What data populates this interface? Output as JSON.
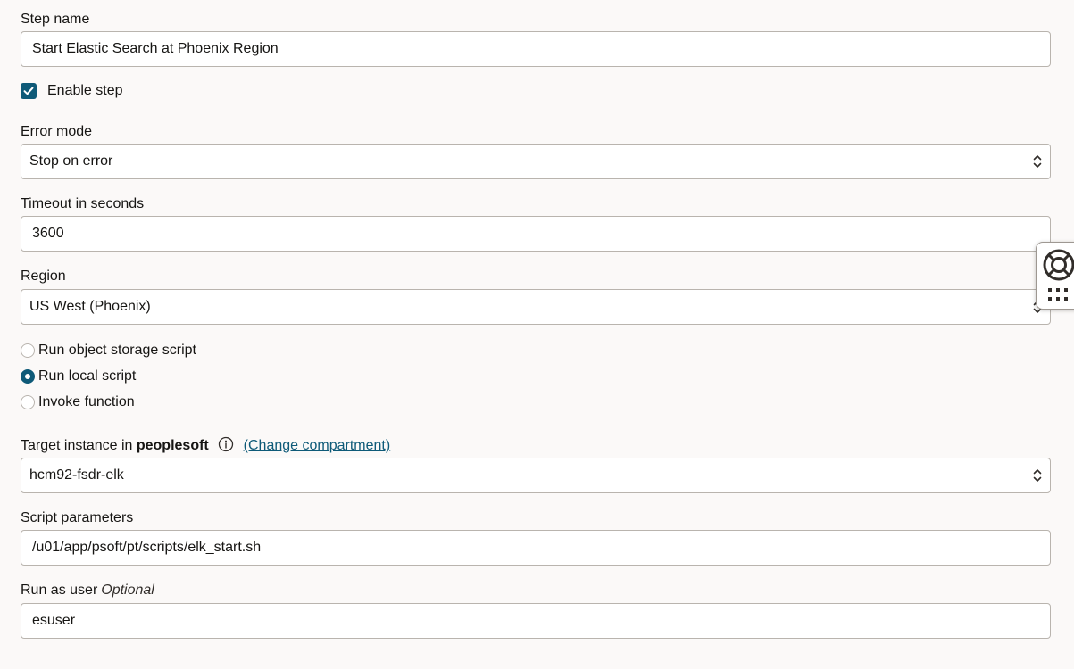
{
  "step_name": {
    "label": "Step name",
    "value": "Start Elastic Search at Phoenix Region"
  },
  "enable_step": {
    "label": "Enable step",
    "checked": true
  },
  "error_mode": {
    "label": "Error mode",
    "value": "Stop on error"
  },
  "timeout": {
    "label": "Timeout in seconds",
    "value": "3600"
  },
  "region": {
    "label": "Region",
    "value": "US West (Phoenix)"
  },
  "script_type": {
    "options": [
      {
        "label": "Run object storage script",
        "selected": false
      },
      {
        "label": "Run local script",
        "selected": true
      },
      {
        "label": "Invoke function",
        "selected": false
      }
    ]
  },
  "target_instance": {
    "label_prefix": "Target instance in",
    "compartment": "peoplesoft",
    "change_link": "(Change compartment)",
    "value": "hcm92-fsdr-elk"
  },
  "script_parameters": {
    "label": "Script parameters",
    "value": "/u01/app/psoft/pt/scripts/elk_start.sh"
  },
  "run_as_user": {
    "label": "Run as user",
    "optional": "Optional",
    "value": "esuser"
  },
  "colors": {
    "accent": "#0e5a78",
    "border": "#b9b4ae",
    "background": "#fbf9f8"
  },
  "icons": {
    "checkbox": "checkmark-icon",
    "select": "chevron-up-down-icon",
    "info": "info-icon",
    "help": "lifebuoy-icon",
    "apps": "grid-dots-icon"
  }
}
